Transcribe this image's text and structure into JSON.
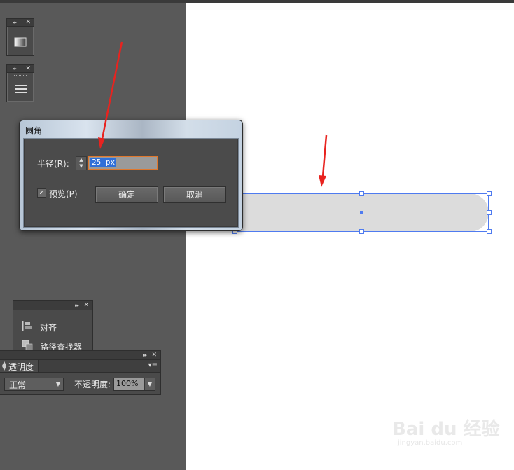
{
  "dialog": {
    "title": "圆角",
    "radius_label": "半径(R):",
    "radius_value": "25 px",
    "preview_label": "预览(P)",
    "preview_checked": true,
    "ok_label": "确定",
    "cancel_label": "取消"
  },
  "panels": {
    "align_label": "对齐",
    "pathfinder_label": "路径查找器",
    "transparency_tab": "透明度",
    "blend_mode": "正常",
    "opacity_label": "不透明度:",
    "opacity_value": "100%"
  },
  "icons": {
    "panel_collapse": "▸▸",
    "panel_close": "✕",
    "dropdown": "▼",
    "checkmark": "✓"
  },
  "watermark": {
    "brand": "Bai du 经验",
    "url": "jingyan.baidu.com"
  },
  "colors": {
    "workspace": "#595959",
    "selection": "#4f7bf0",
    "annotation_arrow": "#e8231f",
    "field_focus": "#e0782d"
  }
}
